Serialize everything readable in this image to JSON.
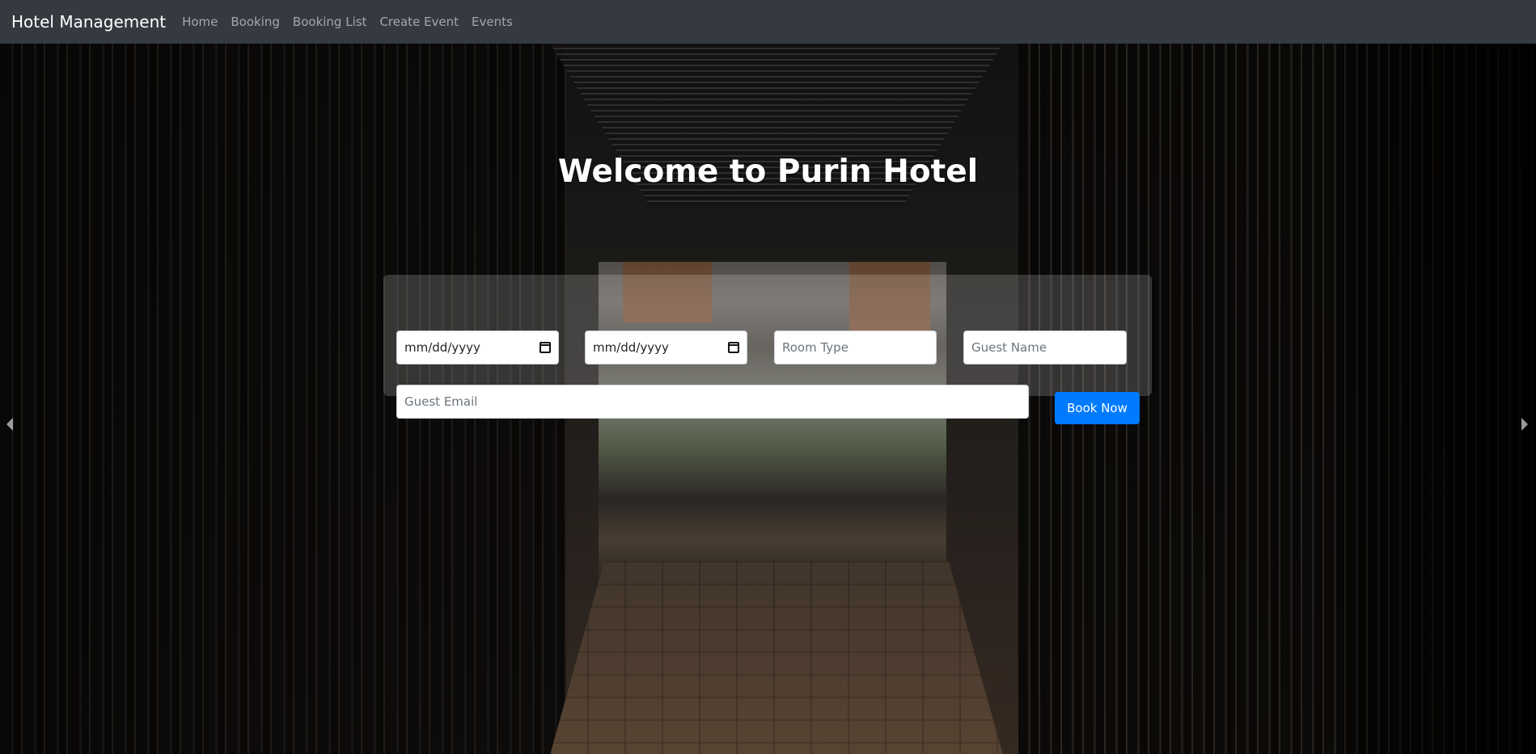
{
  "navbar": {
    "brand": "Hotel Management",
    "links": [
      "Home",
      "Booking",
      "Booking List",
      "Create Event",
      "Events"
    ]
  },
  "hero": {
    "title": "Welcome to Purin Hotel"
  },
  "booking_form": {
    "check_in": {
      "placeholder": "mm/dd/yyyy",
      "icon": "calendar-icon"
    },
    "check_out": {
      "placeholder": "mm/dd/yyyy",
      "icon": "calendar-icon"
    },
    "room_type": {
      "placeholder": "Room Type"
    },
    "guest_name": {
      "placeholder": "Guest Name"
    },
    "guest_email": {
      "placeholder": "Guest Email"
    },
    "submit_label": "Book Now"
  },
  "carousel": {
    "prev_icon": "chevron-left-icon",
    "next_icon": "chevron-right-icon"
  },
  "colors": {
    "navbar_bg": "#343a40",
    "primary": "#007bff"
  }
}
